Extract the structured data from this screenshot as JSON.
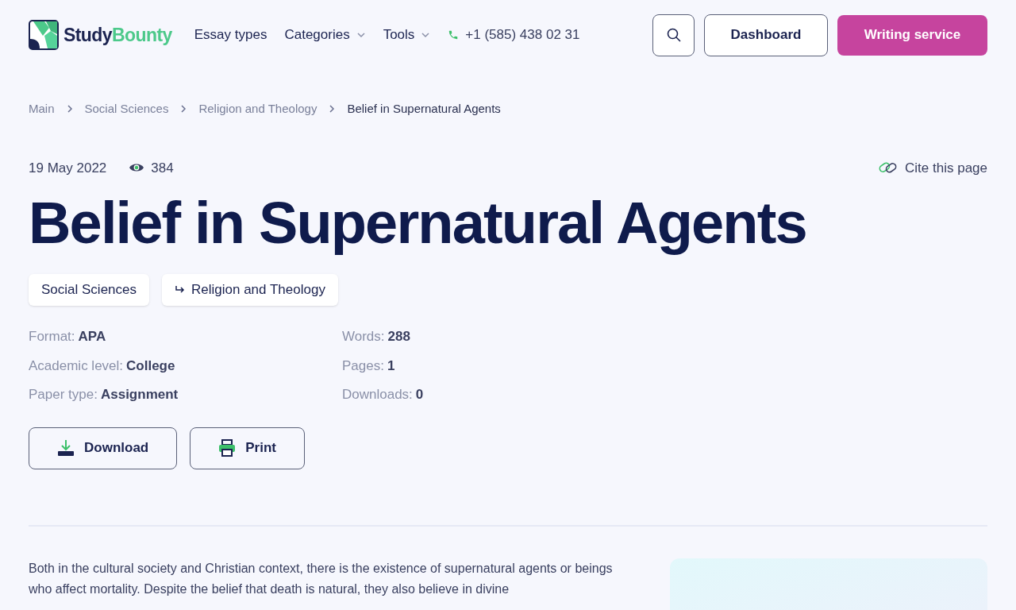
{
  "header": {
    "logo": {
      "part_1": "Study",
      "part_2": "Bounty"
    },
    "nav": [
      {
        "label": "Essay types",
        "has_dropdown": false
      },
      {
        "label": "Categories",
        "has_dropdown": true
      },
      {
        "label": "Tools",
        "has_dropdown": true
      }
    ],
    "phone": "+1 (585) 438 02 31",
    "buttons": [
      {
        "kind": "search"
      },
      {
        "kind": "outline",
        "label": "Dashboard"
      },
      {
        "kind": "primary",
        "label": "Writing service"
      }
    ]
  },
  "breadcrumbs": [
    {
      "label": "Main",
      "current": false
    },
    {
      "label": "Social Sciences",
      "current": false
    },
    {
      "label": "Religion and Theology",
      "current": false
    },
    {
      "label": "Belief in Supernatural Agents",
      "current": true
    }
  ],
  "meta": {
    "date": "19 May 2022",
    "views": "384",
    "cite": "Cite this page"
  },
  "title": "Belief in Supernatural Agents",
  "tags": [
    {
      "label": "Social Sciences",
      "subcategory": false
    },
    {
      "label": "Religion and Theology",
      "subcategory": true
    }
  ],
  "details": [
    [
      {
        "label": "Format:",
        "value": "APA"
      },
      {
        "label": "Academic level:",
        "value": "College"
      },
      {
        "label": "Paper type:",
        "value": "Assignment"
      }
    ],
    [
      {
        "label": "Words:",
        "value": "288"
      },
      {
        "label": "Pages:",
        "value": "1"
      },
      {
        "label": "Downloads:",
        "value": "0"
      }
    ]
  ],
  "actions": [
    {
      "kind": "download",
      "label": "Download"
    },
    {
      "kind": "print",
      "label": "Print"
    }
  ],
  "body": [
    "Both in the cultural society and Christian context, there is the existence of supernatural agents or beings who affect mortality. Despite the belief that death is natural, they also believe in divine"
  ]
}
